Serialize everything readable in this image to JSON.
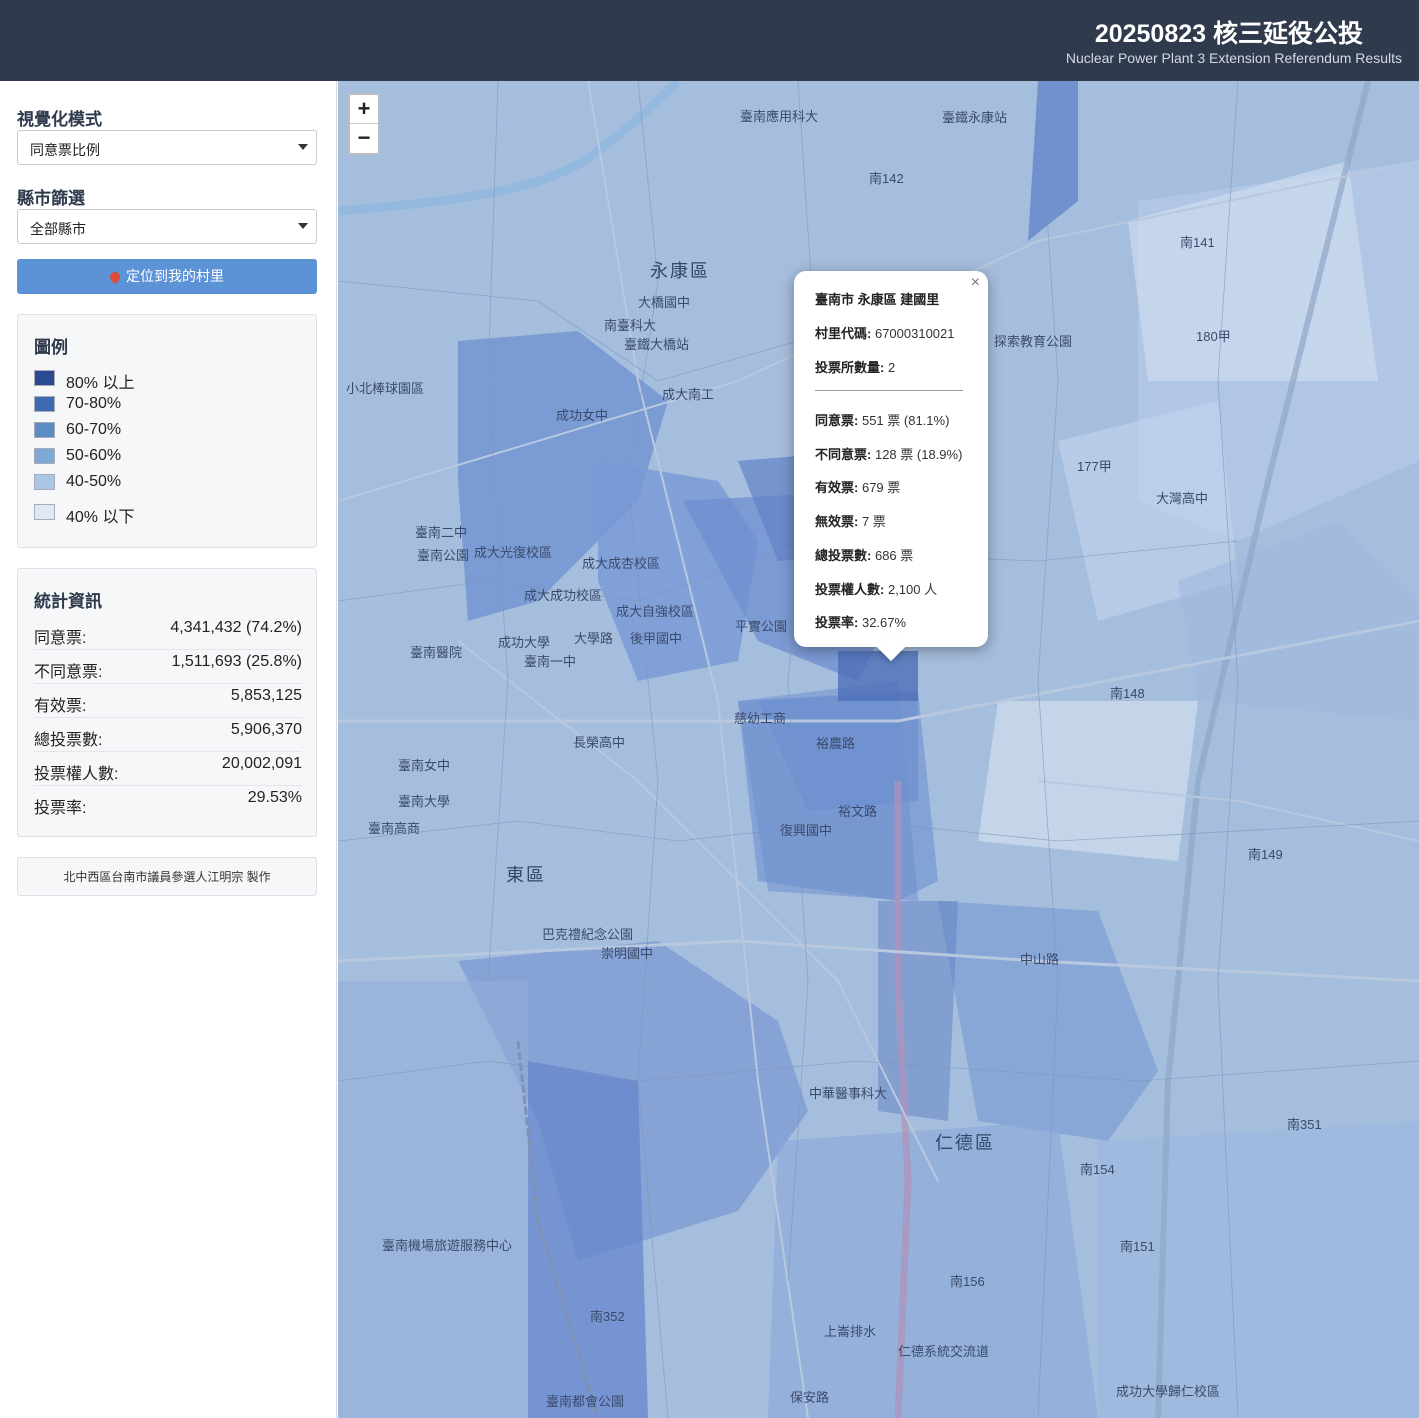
{
  "header": {
    "title": "20250823 核三延役公投",
    "subtitle": "Nuclear Power Plant 3 Extension Referendum Results"
  },
  "sidebar": {
    "mode_label": "視覺化模式",
    "mode_selected": "同意票比例",
    "county_label": "縣市篩選",
    "county_selected": "全部縣市",
    "locate_button": "定位到我的村里",
    "legend": {
      "title": "圖例",
      "items": [
        {
          "label": "80% 以上",
          "color": "#2c4a8f"
        },
        {
          "label": "70-80%",
          "color": "#3e6bb0"
        },
        {
          "label": "60-70%",
          "color": "#5b8cc6"
        },
        {
          "label": "50-60%",
          "color": "#7ea8d6"
        },
        {
          "label": "40-50%",
          "color": "#a9c6e4"
        },
        {
          "label": "40% 以下",
          "color": "#dfe8f4"
        }
      ]
    },
    "stats": {
      "title": "統計資訊",
      "rows": [
        {
          "label": "同意票:",
          "value": "4,341,432 (74.2%)"
        },
        {
          "label": "不同意票:",
          "value": "1,511,693 (25.8%)"
        },
        {
          "label": "有效票:",
          "value": "5,853,125"
        },
        {
          "label": "總投票數:",
          "value": "5,906,370"
        },
        {
          "label": "投票權人數:",
          "value": "20,002,091"
        },
        {
          "label": "投票率:",
          "value": "29.53%"
        }
      ]
    },
    "credit": "北中西區台南市議員參選人江明宗 製作"
  },
  "map": {
    "zoom_in": "+",
    "zoom_out": "−",
    "districts": [
      "永康區",
      "東區",
      "仁德區"
    ],
    "labels": [
      "臺南應用科大",
      "臺鐵永康站",
      "南臺科大",
      "臺鐵大橋站",
      "大橋國中",
      "成大南工",
      "成功女中",
      "小北棒球園區",
      "臺南二中",
      "臺南公園",
      "成大光復校區",
      "成大成功校區",
      "成大自強校區",
      "成大成杏校區",
      "平實公園",
      "臺南醫院",
      "成功大學",
      "臺南一中",
      "大學路",
      "後甲國中",
      "臺南女中",
      "臺南大學",
      "長榮高中",
      "慈幼工商",
      "復興國中",
      "臺南高商",
      "巴克禮紀念公園",
      "崇明國中",
      "中華醫事科大",
      "臺南機場旅遊服務中心",
      "成功大學歸仁校區",
      "大灣高中",
      "探索教育公園",
      "南142",
      "南141",
      "180甲",
      "177甲",
      "南148",
      "南149",
      "南154",
      "南151",
      "南156",
      "南352",
      "南351",
      "中山路",
      "裕農路",
      "裕文路",
      "保安路",
      "臺南都會公園",
      "仁德系統交流道",
      "上崙排水"
    ]
  },
  "popup": {
    "title": "臺南市 永康區 建國里",
    "close": "×",
    "info": [
      {
        "label": "村里代碼:",
        "value": "67000310021"
      },
      {
        "label": "投票所數量:",
        "value": "2"
      }
    ],
    "results": [
      {
        "label": "同意票:",
        "value": "551 票 (81.1%)"
      },
      {
        "label": "不同意票:",
        "value": "128 票 (18.9%)"
      },
      {
        "label": "有效票:",
        "value": "679 票"
      },
      {
        "label": "無效票:",
        "value": "7 票"
      },
      {
        "label": "總投票數:",
        "value": "686 票"
      },
      {
        "label": "投票權人數:",
        "value": "2,100 人"
      },
      {
        "label": "投票率:",
        "value": "32.67%"
      }
    ]
  }
}
